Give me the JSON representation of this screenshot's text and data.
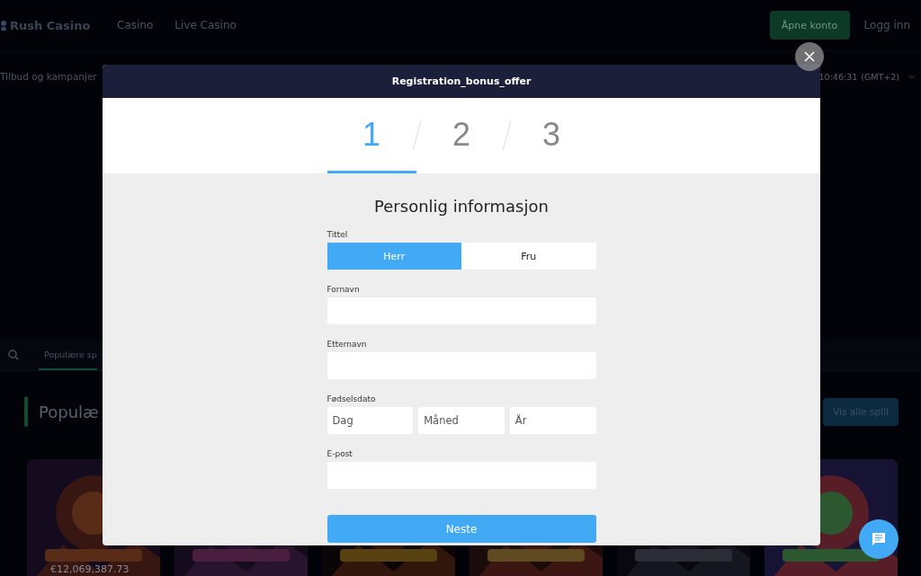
{
  "header": {
    "logo": "Rush Casino",
    "nav": [
      {
        "label": "Casino"
      },
      {
        "label": "Live Casino"
      }
    ],
    "open_account": "Åpne konto",
    "login": "Logg inn"
  },
  "subbar": {
    "promo": "Tilbud og kampanjer",
    "clock": "10:46:31",
    "timezone": "(GMT+2)"
  },
  "games": {
    "tabs": [
      {
        "label": "Populære sp",
        "selected": true
      }
    ],
    "heading": "Populæ",
    "view_all": "Vis alle spill",
    "tiles": [
      {
        "kind": "picture",
        "jackpot": "€12,069,387.73"
      },
      {
        "kind": "picture"
      },
      {
        "kind": "picture"
      },
      {
        "kind": "picture"
      },
      {
        "kind": "picture"
      },
      {
        "kind": "picture"
      }
    ]
  },
  "modal": {
    "title": "Registration_bonus_offer",
    "steps": [
      {
        "label": "1",
        "selected": true
      },
      {
        "label": "2",
        "selected": false
      },
      {
        "label": "3",
        "selected": false
      }
    ],
    "heading": "Personlig informasjon",
    "title_field": {
      "label": "Tittel",
      "options": [
        {
          "label": "Herr",
          "selected": true
        },
        {
          "label": "Fru",
          "selected": false
        }
      ]
    },
    "fields": [
      {
        "label": "Fornavn"
      },
      {
        "label": "Etternavn"
      },
      {
        "label": "Fødselsdato",
        "parts": [
          {
            "placeholder": "Dag"
          },
          {
            "placeholder": "Måned"
          },
          {
            "placeholder": "År"
          }
        ]
      },
      {
        "label": "E-post"
      }
    ],
    "submit": "Neste"
  }
}
